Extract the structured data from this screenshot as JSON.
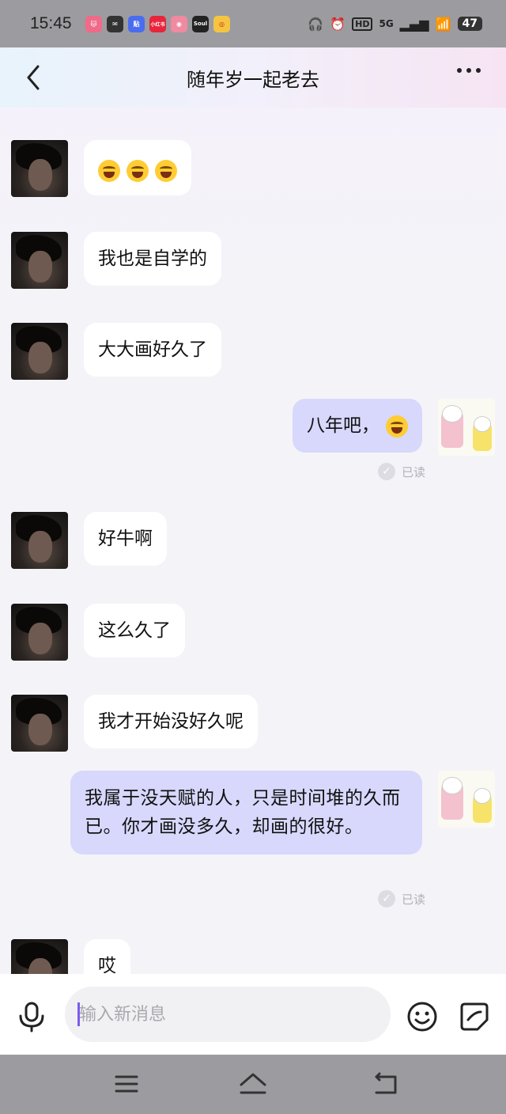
{
  "status_bar": {
    "time": "15:45",
    "apps": [
      {
        "name": "cat-app-icon",
        "color": "#f06a8a",
        "label": ""
      },
      {
        "name": "inbox-app-icon",
        "color": "#333333",
        "label": ""
      },
      {
        "name": "tieba-app-icon",
        "color": "#4a6cf0",
        "label": "贴"
      },
      {
        "name": "xiaohongshu-app-icon",
        "color": "#e8253a",
        "label": "小红书"
      },
      {
        "name": "pink-app-icon",
        "color": "#f08aa0",
        "label": ""
      },
      {
        "name": "soul-app-icon",
        "color": "#222222",
        "label": "Soul"
      },
      {
        "name": "weibo-app-icon",
        "color": "#f5c542",
        "label": ""
      }
    ],
    "network": "5G",
    "battery": "47"
  },
  "header": {
    "title": "随年岁一起老去"
  },
  "messages": [
    {
      "side": "left",
      "type": "emoji",
      "text": "",
      "emoji_count": 3
    },
    {
      "side": "left",
      "text": "我也是自学的"
    },
    {
      "side": "left",
      "text": "大大画好久了"
    },
    {
      "side": "right",
      "text": "八年吧，",
      "read": "已读"
    },
    {
      "side": "left",
      "text": "好牛啊"
    },
    {
      "side": "left",
      "text": "这么久了"
    },
    {
      "side": "left",
      "text": "我才开始没好久呢"
    },
    {
      "side": "right",
      "text": "我属于没天赋的人，只是时间堆的久而已。你才画没多久，却画的很好。",
      "read": "已读"
    },
    {
      "side": "left",
      "text": "哎"
    }
  ],
  "input": {
    "placeholder": "输入新消息"
  }
}
